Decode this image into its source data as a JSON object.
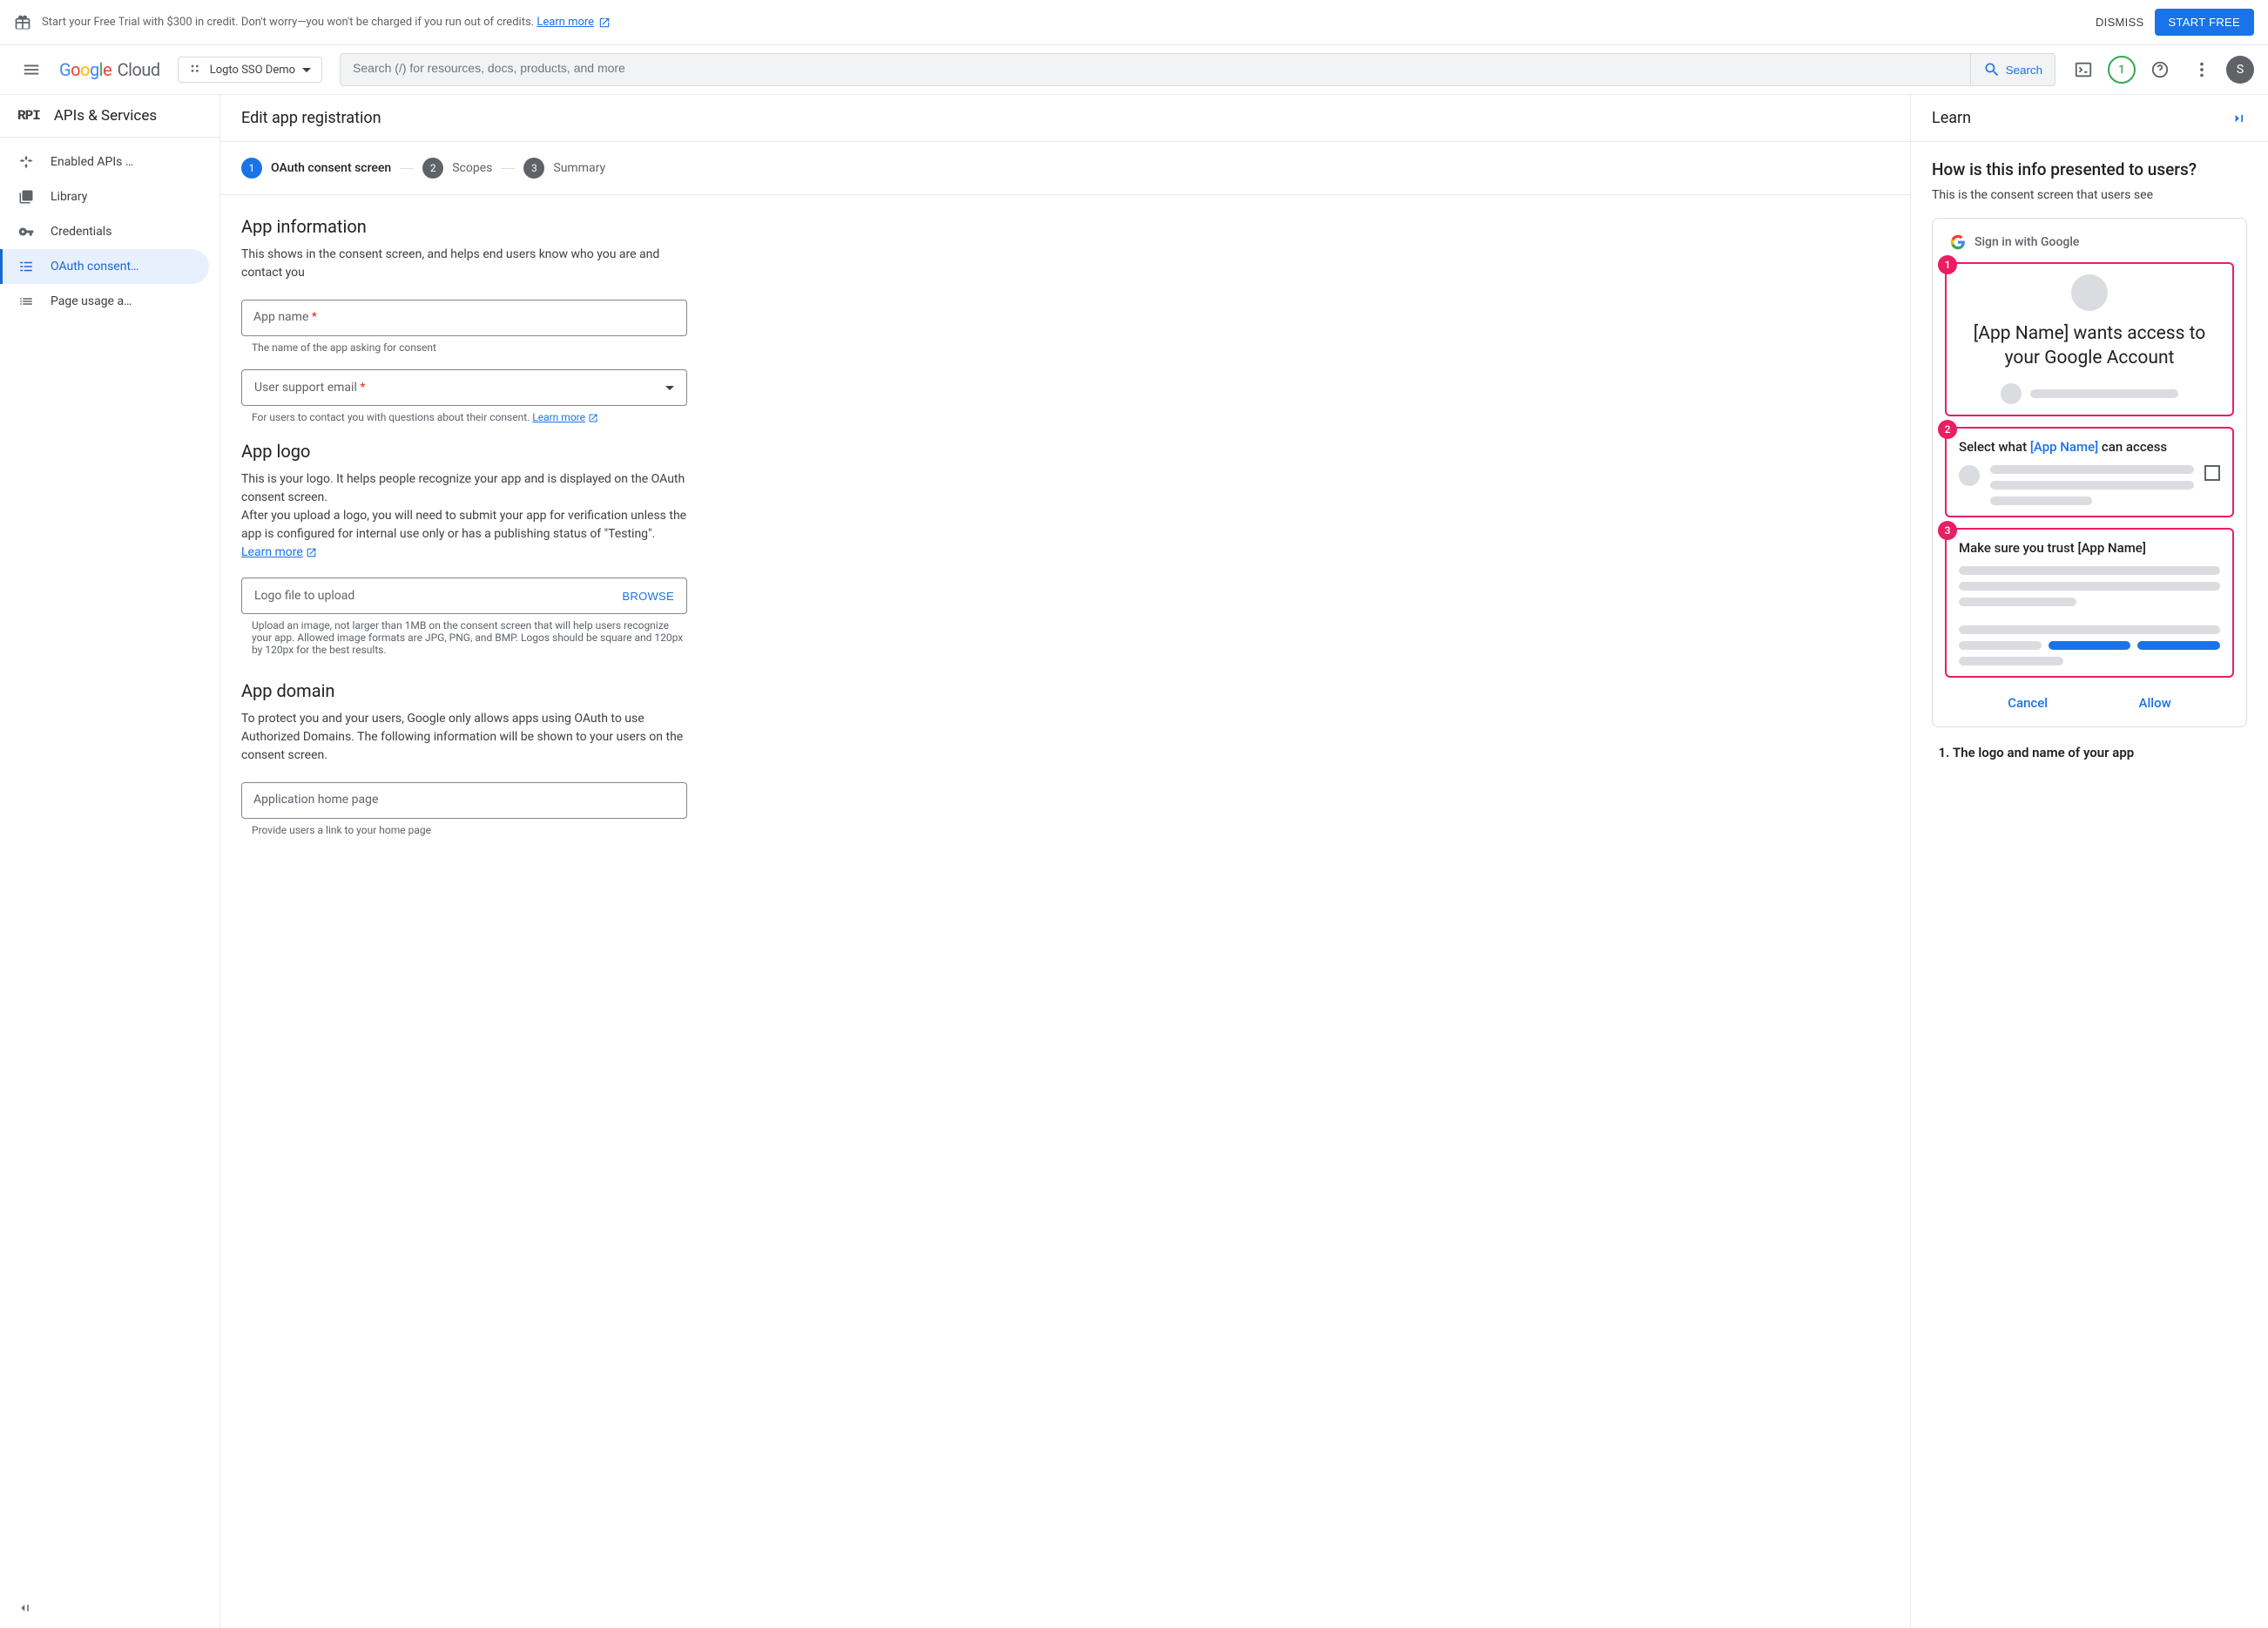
{
  "promo": {
    "text": "Start your Free Trial with $300 in credit. Don't worry—you won't be charged if you run out of credits. ",
    "learn_more": "Learn more",
    "dismiss": "DISMISS",
    "start_free": "START FREE"
  },
  "header": {
    "project_name": "Logto SSO Demo",
    "search_placeholder": "Search (/) for resources, docs, products, and more",
    "search_label": "Search",
    "trial_count": "1",
    "avatar_initial": "S"
  },
  "sidebar": {
    "title": "APIs & Services",
    "items": [
      {
        "label": "Enabled APIs …"
      },
      {
        "label": "Library"
      },
      {
        "label": "Credentials"
      },
      {
        "label": "OAuth consent…"
      },
      {
        "label": "Page usage a…"
      }
    ]
  },
  "main": {
    "title": "Edit app registration",
    "steps": [
      {
        "num": "1",
        "label": "OAuth consent screen"
      },
      {
        "num": "2",
        "label": "Scopes"
      },
      {
        "num": "3",
        "label": "Summary"
      }
    ],
    "app_info": {
      "heading": "App information",
      "desc": "This shows in the consent screen, and helps end users know who you are and contact you",
      "app_name_label": "App name",
      "app_name_helper": "The name of the app asking for consent",
      "support_email_label": "User support email",
      "support_email_helper": "For users to contact you with questions about their consent. ",
      "learn_more": "Learn more"
    },
    "app_logo": {
      "heading": "App logo",
      "desc1": "This is your logo. It helps people recognize your app and is displayed on the OAuth consent screen.",
      "desc2": "After you upload a logo, you will need to submit your app for verification unless the app is configured for internal use only or has a publishing status of \"Testing\". ",
      "learn_more": "Learn more",
      "upload_label": "Logo file to upload",
      "browse": "BROWSE",
      "upload_helper": "Upload an image, not larger than 1MB on the consent screen that will help users recognize your app. Allowed image formats are JPG, PNG, and BMP. Logos should be square and 120px by 120px for the best results."
    },
    "app_domain": {
      "heading": "App domain",
      "desc": "To protect you and your users, Google only allows apps using OAuth to use Authorized Domains. The following information will be shown to your users on the consent screen.",
      "home_page_label": "Application home page",
      "home_page_helper": "Provide users a link to your home page"
    }
  },
  "learn": {
    "title": "Learn",
    "heading": "How is this info presented to users?",
    "subtitle": "This is the consent screen that users see",
    "signin": "Sign in with Google",
    "preview_title": "[App Name] wants access to your Google Account",
    "select_what": "Select what ",
    "app_name": "[App Name]",
    "can_access": " can access",
    "trust": "Make sure you trust [App Name]",
    "cancel": "Cancel",
    "allow": "Allow",
    "list_1": "The logo and name of your app"
  }
}
